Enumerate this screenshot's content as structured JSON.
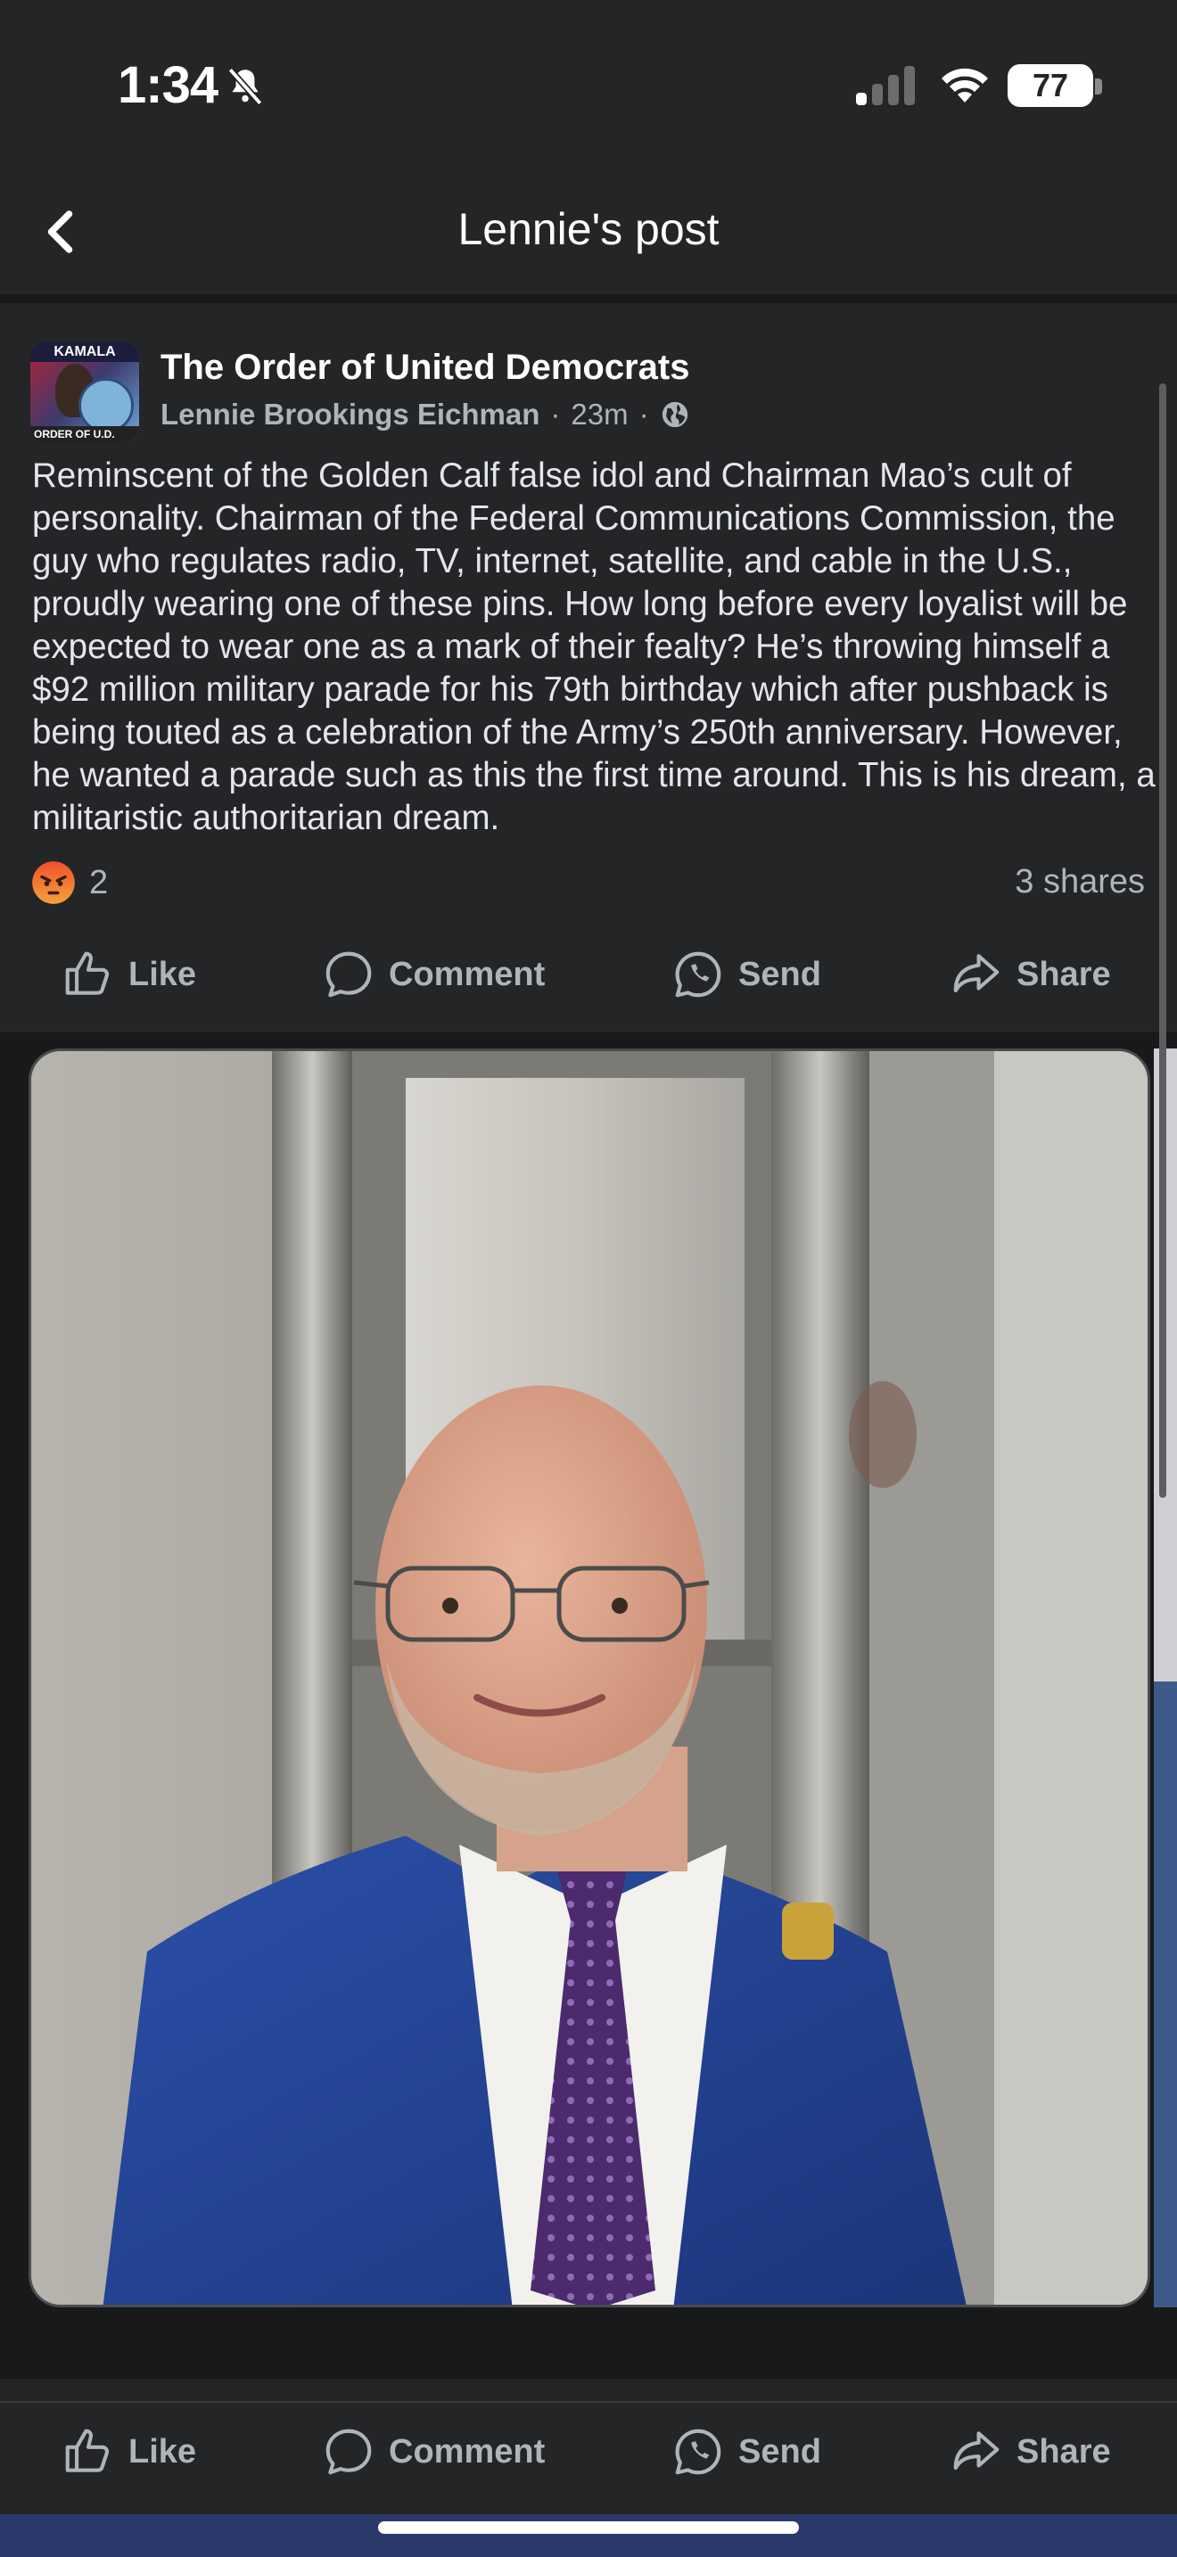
{
  "status_bar": {
    "time": "1:34",
    "battery": "77"
  },
  "header": {
    "title": "Lennie's post"
  },
  "post": {
    "group_name": "The Order of United Democrats",
    "author": "Lennie Brookings Eichman",
    "time": "23m",
    "separator": "·",
    "avatar_text_top": "KAMALA",
    "avatar_text_bottom": "ORDER OF U.D.",
    "body": "Reminscent of the Golden Calf false idol and Chairman Mao’s cult of personality. Chairman of the Federal Communications Commission, the guy who regulates radio, TV, internet, satellite, and cable in the U.S., proudly wearing one of these pins. How long before every loyalist will be expected to wear one as a mark of their fealty? He’s throwing himself a $92 million military parade for his 79th birthday which after pushback is being touted as a celebration of the Army’s 250th anniversary. However, he wanted a parade such as this the first time around. This is his dream, a militaristic authoritarian dream.",
    "reaction_count": "2",
    "shares": "3 shares"
  },
  "actions": {
    "like": "Like",
    "comment": "Comment",
    "send": "Send",
    "share": "Share"
  },
  "icons": {
    "back": "chevron-left-icon",
    "bell": "bell-off-icon",
    "globe": "globe-icon",
    "reaction": "angry-face-icon"
  },
  "colors": {
    "background": "#242526",
    "text": "#e4e6eb",
    "muted": "#b0b3b8",
    "angry": "#f0743a"
  }
}
